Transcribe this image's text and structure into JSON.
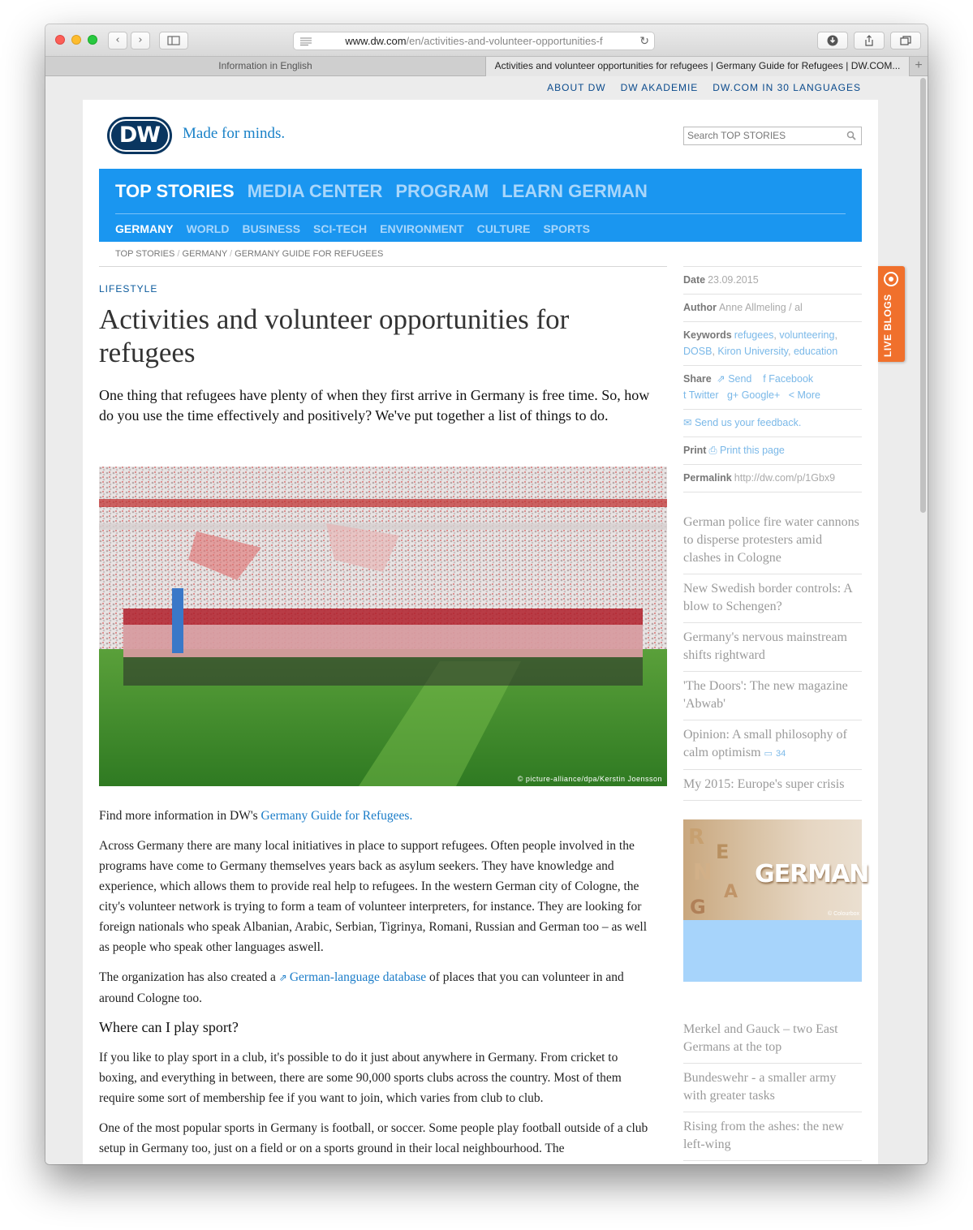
{
  "browser": {
    "url_host": "www.dw.com",
    "url_path": "/en/activities-and-volunteer-opportunities-f",
    "tabs": [
      "Information in English",
      "Activities and volunteer opportunities for refugees | Germany Guide for Refugees | DW.COM..."
    ]
  },
  "top_links": [
    "ABOUT DW",
    "DW AKADEMIE",
    "DW.COM IN 30 LANGUAGES"
  ],
  "header": {
    "logo": "DW",
    "tagline": "Made for minds.",
    "search_placeholder": "Search TOP STORIES"
  },
  "nav": {
    "main": [
      "TOP STORIES",
      "MEDIA CENTER",
      "PROGRAM",
      "LEARN GERMAN"
    ],
    "sub": [
      "GERMANY",
      "WORLD",
      "BUSINESS",
      "SCI-TECH",
      "ENVIRONMENT",
      "CULTURE",
      "SPORTS"
    ]
  },
  "breadcrumb": [
    "TOP STORIES",
    "GERMANY",
    "GERMANY GUIDE FOR REFUGEES"
  ],
  "article": {
    "kicker": "LIFESTYLE",
    "title": "Activities and volunteer opportunities for refugees",
    "lead": "One thing that refugees have plenty of when they first arrive in Germany is free time. So, how do you use the time effectively and positively? We've put together a list of things to do.",
    "photo_credit": "© picture-alliance/dpa/Kerstin Joensson",
    "p1_text": "Find more information in DW's ",
    "p1_link": "Germany Guide for Refugees.",
    "p2": "Across Germany there are many local initiatives in place to support refugees. Often people involved in the programs have come to Germany themselves years back as asylum seekers. They have knowledge and experience, which allows them to provide real help to refugees. In the western German city of Cologne, the city's volunteer network is trying to form a team of volunteer interpreters, for instance. They are looking for foreign nationals who speak Albanian, Arabic, Serbian, Tigrinya, Romani, Russian and German too – as well as people who speak other languages aswell.",
    "p3_before": "The organization has also created a ",
    "p3_link": "German-language database",
    "p3_after": " of places that you can volunteer in and around Cologne too.",
    "h_sport": "Where can I play sport?",
    "p4": "If you like to play sport in a club, it's possible to do it just about anywhere in Germany. From cricket to boxing, and everything in between, there are some 90,000 sports clubs across the country. Most of them require some sort of membership fee if you want to join, which varies from club to club.",
    "p5": "One of the most popular sports in Germany is football, or soccer. Some people play football outside of a club setup in Germany too, just on a field or on a sports ground in their local neighbourhood. The"
  },
  "meta": {
    "date_label": "Date",
    "date": "23.09.2015",
    "author_label": "Author",
    "author": "Anne Allmeling / al",
    "keywords_label": "Keywords",
    "keywords": [
      "refugees",
      "volunteering",
      "DOSB",
      "Kiron University",
      "education"
    ],
    "share_label": "Share",
    "share": [
      "Send",
      "Facebook",
      "Twitter",
      "Google+",
      "More"
    ],
    "feedback": "Send us your feedback.",
    "print_label": "Print",
    "print": "Print this page",
    "permalink_label": "Permalink",
    "permalink": "http://dw.com/p/1Gbx9"
  },
  "related_top": [
    "German police fire water cannons to disperse protesters amid clashes in Cologne",
    "New Swedish border controls: A blow to Schengen?",
    "Germany's nervous mainstream shifts rightward",
    "'The Doors': The new magazine 'Abwab'",
    "Opinion: A small philosophy of calm optimism",
    "My 2015: Europe's super crisis"
  ],
  "related_comment_count": "34",
  "promo": {
    "word": "GERMAN",
    "credit": "© Colourbox"
  },
  "related_bottom": [
    "Merkel and Gauck – two East Germans at the top",
    "Bundeswehr - a smaller army with greater tasks",
    "Rising from the ashes: the new left-wing"
  ],
  "live_blogs": "LIVE BLOGS",
  "colors": {
    "dw_blue": "#1a96f0",
    "dw_navy": "#0a3660",
    "live_orange": "#f0702c",
    "link": "#1a7cc8"
  }
}
